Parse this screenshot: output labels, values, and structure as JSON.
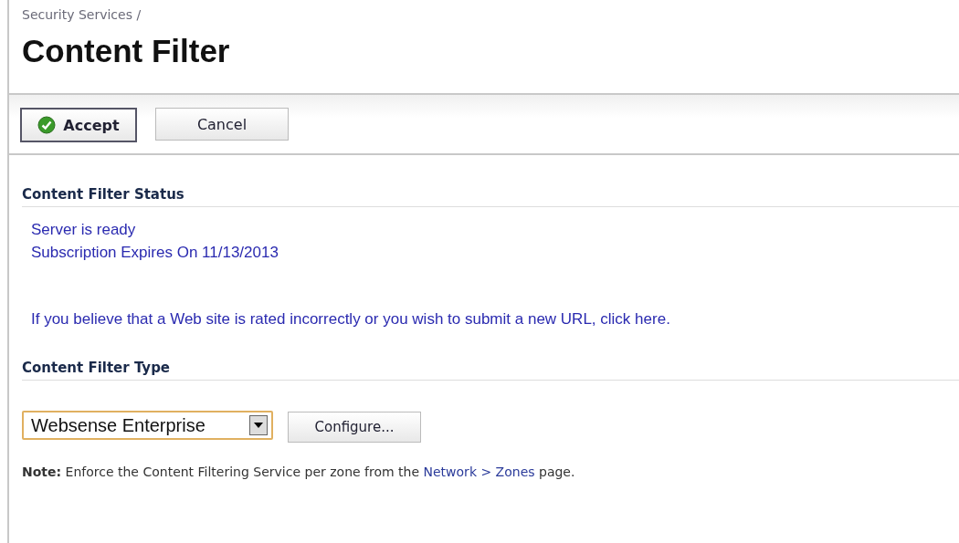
{
  "breadcrumb": "Security Services /",
  "title": "Content Filter",
  "toolbar": [
    {
      "label": "Accept",
      "kind": "primary"
    },
    {
      "label": "Cancel",
      "kind": "plain"
    }
  ],
  "status_section": {
    "heading": "Content Filter Status",
    "lines": [
      "Server is ready",
      "Subscription Expires On 11/13/2013"
    ],
    "notice": {
      "before": "If you believe that a Web site is rated incorrectly or you wish to submit a new URL, ",
      "link": "click here",
      "after": "."
    }
  },
  "type_section": {
    "heading": "Content Filter Type",
    "select": {
      "value": "Websense Enterprise"
    },
    "button": "Configure...",
    "note": {
      "label": "Note:",
      "before": " Enforce the Content Filtering Service per zone from the ",
      "link": "Network > Zones",
      "after": " page."
    }
  }
}
